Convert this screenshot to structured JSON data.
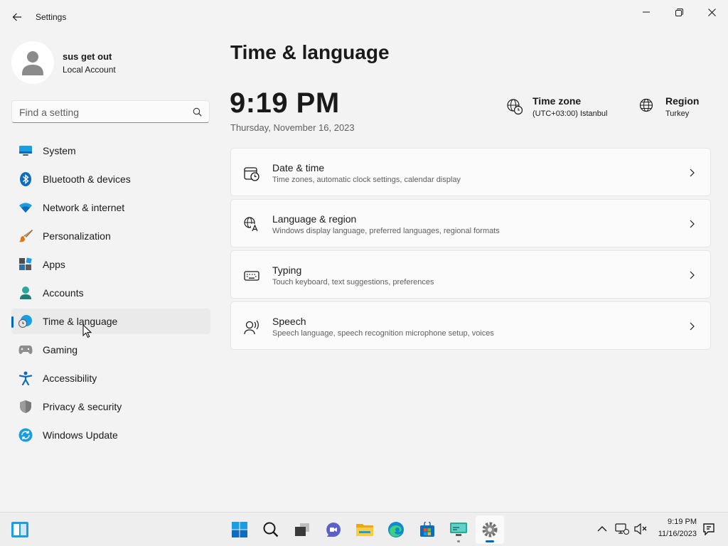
{
  "window": {
    "title": "Settings"
  },
  "account": {
    "name": "sus get out",
    "type": "Local Account"
  },
  "search": {
    "placeholder": "Find a setting"
  },
  "sidebar": {
    "items": [
      {
        "label": "System",
        "icon": "monitor-icon"
      },
      {
        "label": "Bluetooth & devices",
        "icon": "bluetooth-icon"
      },
      {
        "label": "Network & internet",
        "icon": "wifi-icon"
      },
      {
        "label": "Personalization",
        "icon": "brush-icon"
      },
      {
        "label": "Apps",
        "icon": "apps-icon"
      },
      {
        "label": "Accounts",
        "icon": "person-icon"
      },
      {
        "label": "Time & language",
        "icon": "globe-clock-icon",
        "active": true
      },
      {
        "label": "Gaming",
        "icon": "gamepad-icon"
      },
      {
        "label": "Accessibility",
        "icon": "accessibility-icon"
      },
      {
        "label": "Privacy & security",
        "icon": "shield-icon"
      },
      {
        "label": "Windows Update",
        "icon": "update-icon"
      }
    ]
  },
  "main": {
    "title": "Time & language",
    "clock": "9:19 PM",
    "date": "Thursday, November 16, 2023",
    "time_zone": {
      "title": "Time zone",
      "value": "(UTC+03:00) Istanbul"
    },
    "region": {
      "title": "Region",
      "value": "Turkey"
    },
    "cards": [
      {
        "title": "Date & time",
        "subtitle": "Time zones, automatic clock settings, calendar display",
        "icon": "calendar-clock-icon"
      },
      {
        "title": "Language & region",
        "subtitle": "Windows display language, preferred languages, regional formats",
        "icon": "language-icon"
      },
      {
        "title": "Typing",
        "subtitle": "Touch keyboard, text suggestions, preferences",
        "icon": "keyboard-icon"
      },
      {
        "title": "Speech",
        "subtitle": "Speech language, speech recognition microphone setup, voices",
        "icon": "speech-icon"
      }
    ]
  },
  "taskbar": {
    "time": "9:19 PM",
    "date": "11/16/2023",
    "apps": [
      "widgets-icon",
      "start-icon",
      "search-icon",
      "task-view-icon",
      "chat-icon",
      "file-explorer-icon",
      "edge-icon",
      "store-icon",
      "remote-desktop-icon",
      "settings-icon"
    ]
  },
  "colors": {
    "accent": "#0067c0",
    "background": "#f3f3f3",
    "card": "#fbfbfb"
  }
}
